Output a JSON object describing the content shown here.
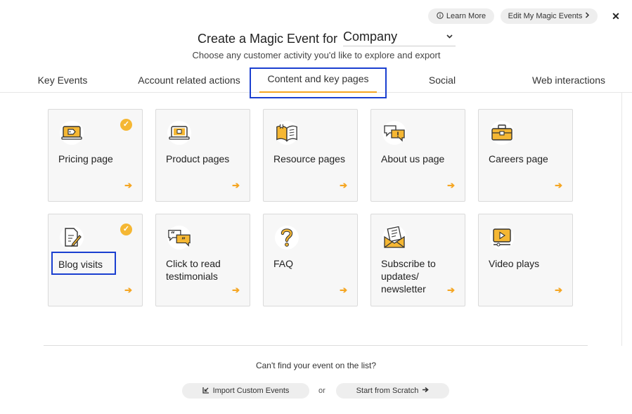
{
  "header": {
    "learn_more": "Learn More",
    "edit_magic_events": "Edit My Magic Events",
    "close": "✕",
    "title": "Create a Magic Event for",
    "company_select": "Company",
    "subtitle": "Choose any customer activity you'd like to explore and export"
  },
  "tabs": [
    {
      "label": "Key Events"
    },
    {
      "label": "Account related actions"
    },
    {
      "label": "Content and key pages",
      "active": true
    },
    {
      "label": "Social"
    },
    {
      "label": "Web interactions"
    }
  ],
  "cards": [
    {
      "label": "Pricing page",
      "icon": "price-tag-icon",
      "checked": true
    },
    {
      "label": "Product pages",
      "icon": "laptop-icon",
      "checked": false
    },
    {
      "label": "Resource pages",
      "icon": "book-icon",
      "checked": false
    },
    {
      "label": "About us page",
      "icon": "chat-bubbles-icon",
      "checked": false
    },
    {
      "label": "Careers page",
      "icon": "briefcase-icon",
      "checked": false
    },
    {
      "label": "Blog visits",
      "icon": "document-pen-icon",
      "checked": true,
      "highlighted": true
    },
    {
      "label": "Click to read testimonials",
      "icon": "quote-bubbles-icon",
      "checked": false
    },
    {
      "label": "FAQ",
      "icon": "question-mark-icon",
      "checked": false
    },
    {
      "label": "Subscribe to updates/ newsletter",
      "icon": "envelope-icon",
      "checked": false
    },
    {
      "label": "Video plays",
      "icon": "video-player-icon",
      "checked": false
    }
  ],
  "footer": {
    "cant_find": "Can't find your event on the list?",
    "import_custom": "Import Custom Events",
    "or": "or",
    "start_scratch": "Start from Scratch"
  },
  "colors": {
    "accent": "#f5a623",
    "highlight": "#1a3fd0",
    "card_bg": "#f7f7f7"
  }
}
